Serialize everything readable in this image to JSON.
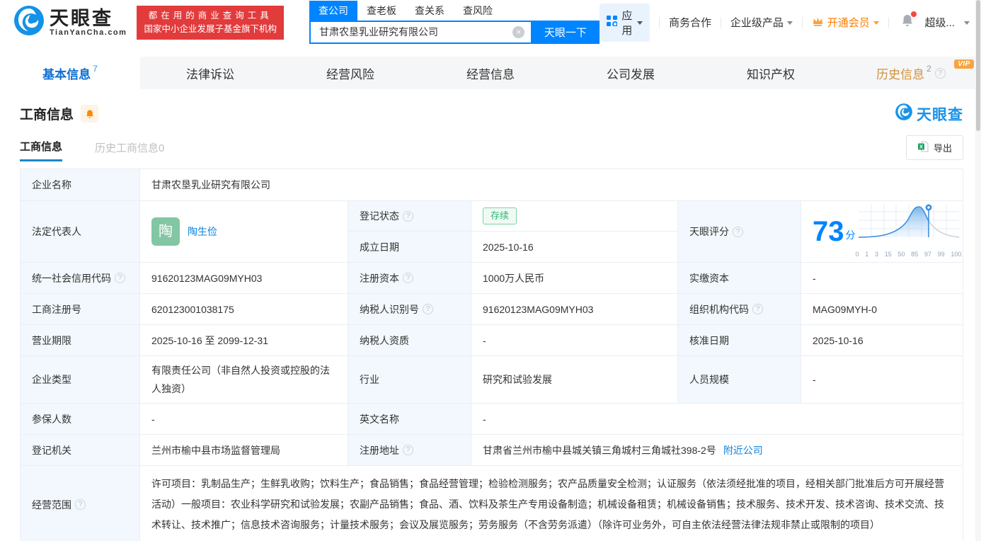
{
  "brand": {
    "name": "天眼查",
    "domain": "TianYanCha.com",
    "promo_line1": "都在用的商业查询工具",
    "promo_line2": "国家中小企业发展子基金旗下机构"
  },
  "search": {
    "tabs": [
      "查公司",
      "查老板",
      "查关系",
      "查风险"
    ],
    "value": "甘肃农垦乳业研究有限公司",
    "button": "天眼一下"
  },
  "topmenu": {
    "apps": "应用",
    "cooperation": "商务合作",
    "enterprise": "企业级产品",
    "vip": "开通会员",
    "user": "超级..."
  },
  "nav": {
    "tabs": [
      {
        "label": "基本信息",
        "count": "7"
      },
      {
        "label": "法律诉讼"
      },
      {
        "label": "经营风险"
      },
      {
        "label": "经营信息"
      },
      {
        "label": "公司发展"
      },
      {
        "label": "知识产权"
      },
      {
        "label": "历史信息",
        "count": "2",
        "badge": "VIP"
      }
    ]
  },
  "section": {
    "title": "工商信息",
    "watermark": "天眼查"
  },
  "subtabs": {
    "current": "工商信息",
    "history": "历史工商信息0",
    "export": "导出"
  },
  "fields": {
    "company_name": {
      "label": "企业名称",
      "value": "甘肃农垦乳业研究有限公司"
    },
    "legal_rep": {
      "label": "法定代表人",
      "avatar": "陶",
      "name": "陶生俭"
    },
    "reg_status": {
      "label": "登记状态",
      "value": "存续"
    },
    "establish_date": {
      "label": "成立日期",
      "value": "2025-10-16"
    },
    "score_field": {
      "label": "天眼评分"
    },
    "credit_code": {
      "label": "统一社会信用代码",
      "value": "91620123MAG09MYH03"
    },
    "reg_capital": {
      "label": "注册资本",
      "value": "1000万人民币"
    },
    "paid_capital": {
      "label": "实缴资本",
      "value": "-"
    },
    "reg_number": {
      "label": "工商注册号",
      "value": "620123001038175"
    },
    "taxpayer_id": {
      "label": "纳税人识别号",
      "value": "91620123MAG09MYH03"
    },
    "org_code": {
      "label": "组织机构代码",
      "value": "MAG09MYH-0"
    },
    "business_term": {
      "label": "营业期限",
      "value": "2025-10-16 至 2099-12-31"
    },
    "taxpayer_quality": {
      "label": "纳税人资质",
      "value": "-"
    },
    "approval_date": {
      "label": "核准日期",
      "value": "2025-10-16"
    },
    "company_type": {
      "label": "企业类型",
      "value": "有限责任公司（非自然人投资或控股的法人独资）"
    },
    "industry": {
      "label": "行业",
      "value": "研究和试验发展"
    },
    "staff_size": {
      "label": "人员规模",
      "value": "-"
    },
    "insured_count": {
      "label": "参保人数",
      "value": "-"
    },
    "english_name": {
      "label": "英文名称",
      "value": "-"
    },
    "reg_authority": {
      "label": "登记机关",
      "value": "兰州市榆中县市场监督管理局"
    },
    "reg_address": {
      "label": "注册地址",
      "value": "甘肃省兰州市榆中县城关镇三角城村三角城社398-2号",
      "link": "附近公司"
    },
    "business_scope": {
      "label": "经营范围",
      "value": "许可项目：乳制品生产；生鲜乳收购；饮料生产；食品销售；食品经营管理；检验检测服务；农产品质量安全检测；认证服务（依法须经批准的项目，经相关部门批准后方可开展经营活动）一般项目：农业科学研究和试验发展；农副产品销售；食品、酒、饮料及茶生产专用设备制造；机械设备租赁；机械设备销售；技术服务、技术开发、技术咨询、技术交流、技术转让、技术推广；信息技术咨询服务；计量技术服务；会议及展览服务；劳务服务（不含劳务派遣）（除许可业务外，可自主依法经营法律法规非禁止或限制的项目）"
    }
  },
  "score": {
    "value": "73",
    "unit": "分",
    "axis": [
      "0",
      "1",
      "3",
      "15",
      "50",
      "85",
      "97",
      "99",
      "100"
    ]
  }
}
